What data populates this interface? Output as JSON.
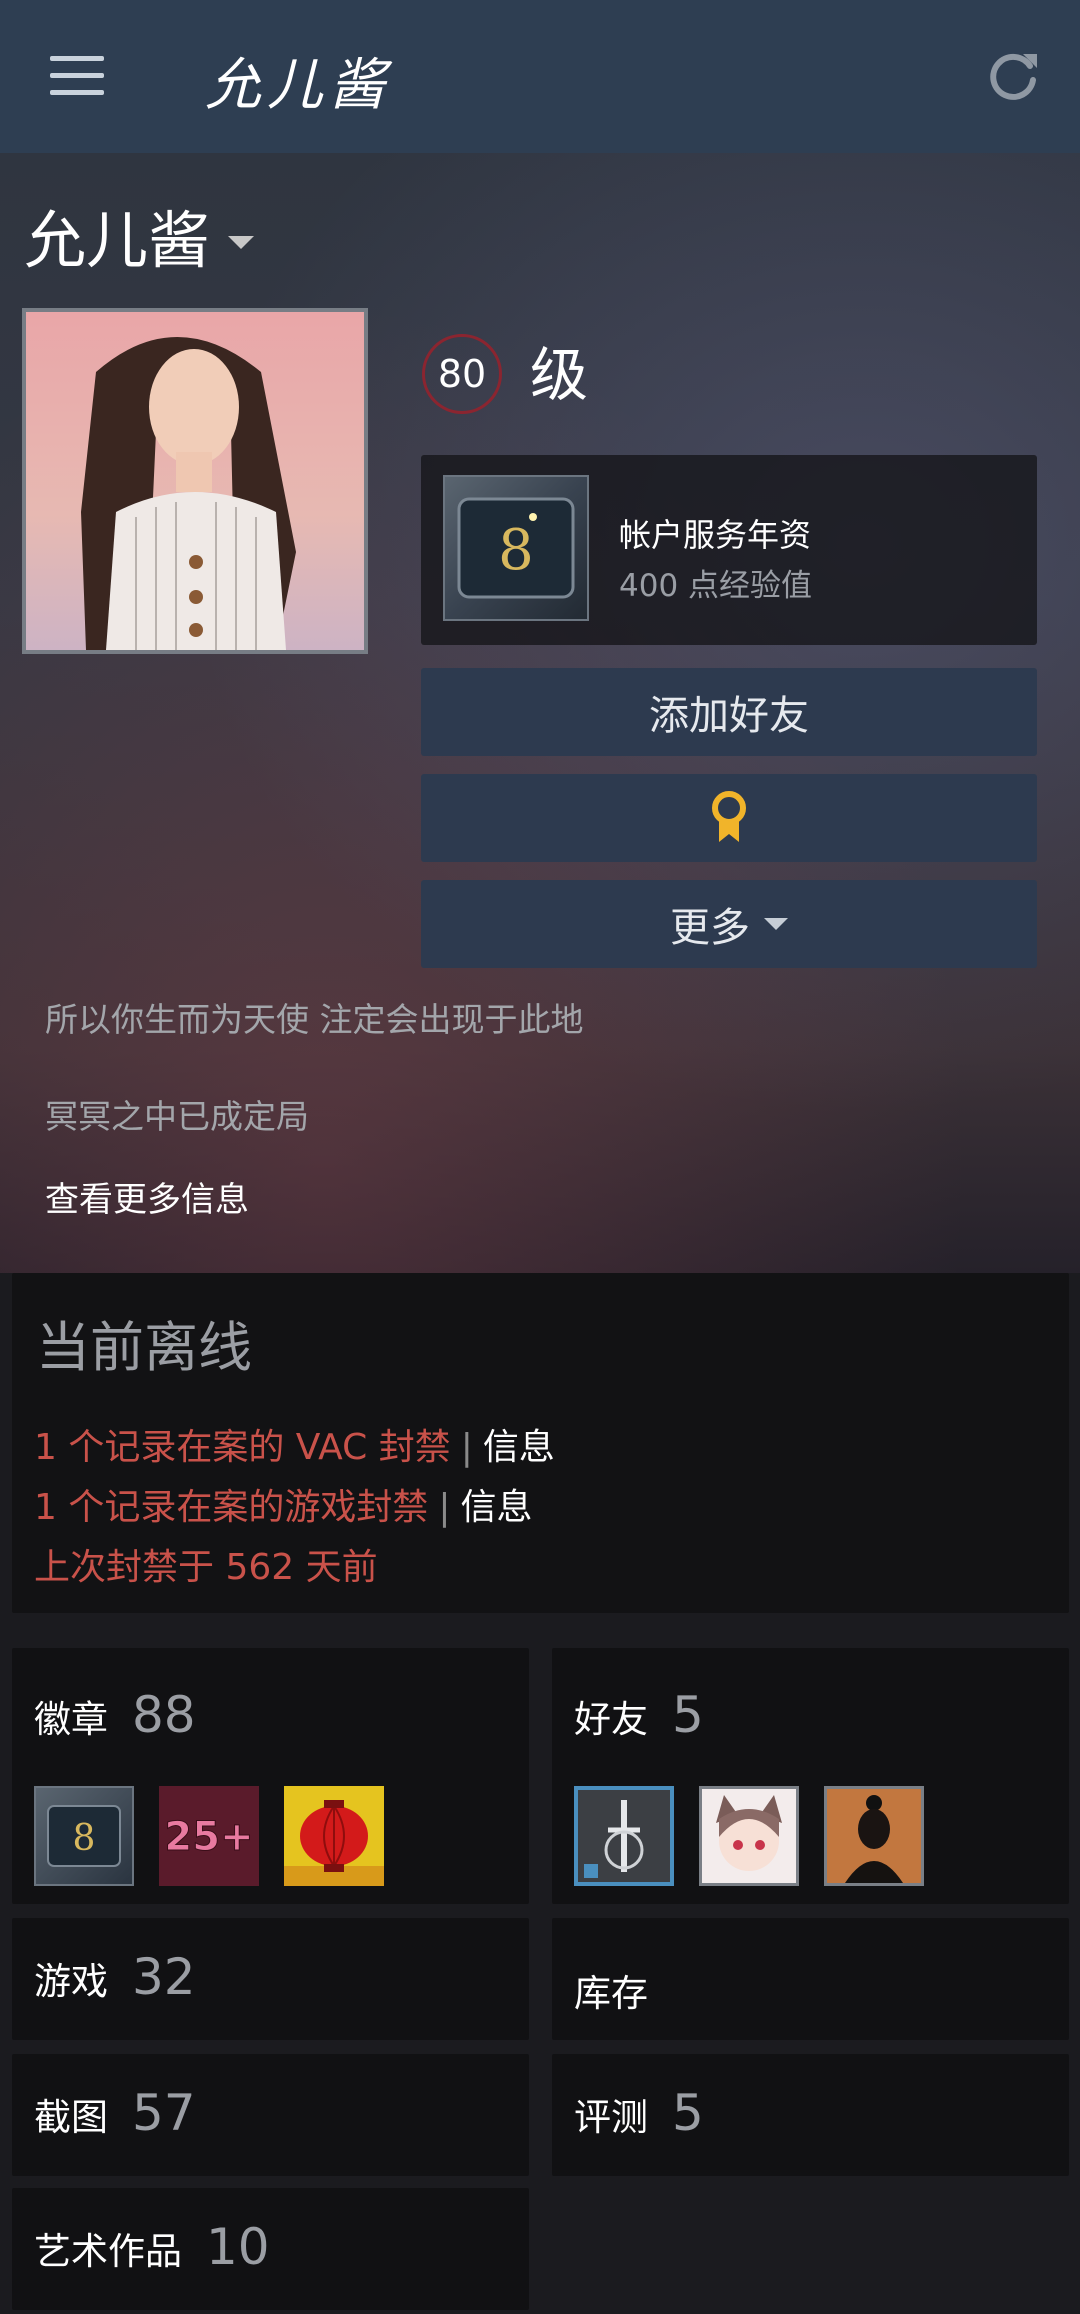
{
  "header": {
    "title": "允儿酱"
  },
  "profile": {
    "name": "允儿酱",
    "level": "80",
    "level_label": "级",
    "featured_badge": {
      "title": "帐户服务年资",
      "xp": "400 点经验值",
      "number": "8"
    },
    "buttons": {
      "add_friend": "添加好友",
      "more": "更多"
    },
    "bio": [
      "所以你生而为天使 注定会出现于此地",
      "冥冥之中已成定局"
    ],
    "more_info_link": "查看更多信息"
  },
  "status": {
    "title": "当前离线",
    "bans": [
      {
        "text": "1 个记录在案的 VAC 封禁",
        "link": "信息"
      },
      {
        "text": "1 个记录在案的游戏封禁",
        "link": "信息"
      }
    ],
    "last_ban": "上次封禁于 562 天前"
  },
  "tiles": {
    "badges": {
      "label": "徽章",
      "count": "88",
      "badge_thumbs": [
        "8",
        "25+",
        "lantern"
      ]
    },
    "friends": {
      "label": "好友",
      "count": "5"
    },
    "games": {
      "label": "游戏",
      "count": "32"
    },
    "inventory": {
      "label": "库存"
    },
    "screenshots": {
      "label": "截图",
      "count": "57"
    },
    "reviews": {
      "label": "评测",
      "count": "5"
    },
    "artwork": {
      "label": "艺术作品",
      "count": "10"
    }
  },
  "colors": {
    "topbar": "#2e3e52",
    "button": "#2d3a4f",
    "ban_red": "#c9524a",
    "level_ring": "#8b2530",
    "award_gold": "#f1b42a"
  },
  "icons": [
    "menu-icon",
    "refresh-icon",
    "award-icon",
    "caret-down-icon"
  ]
}
